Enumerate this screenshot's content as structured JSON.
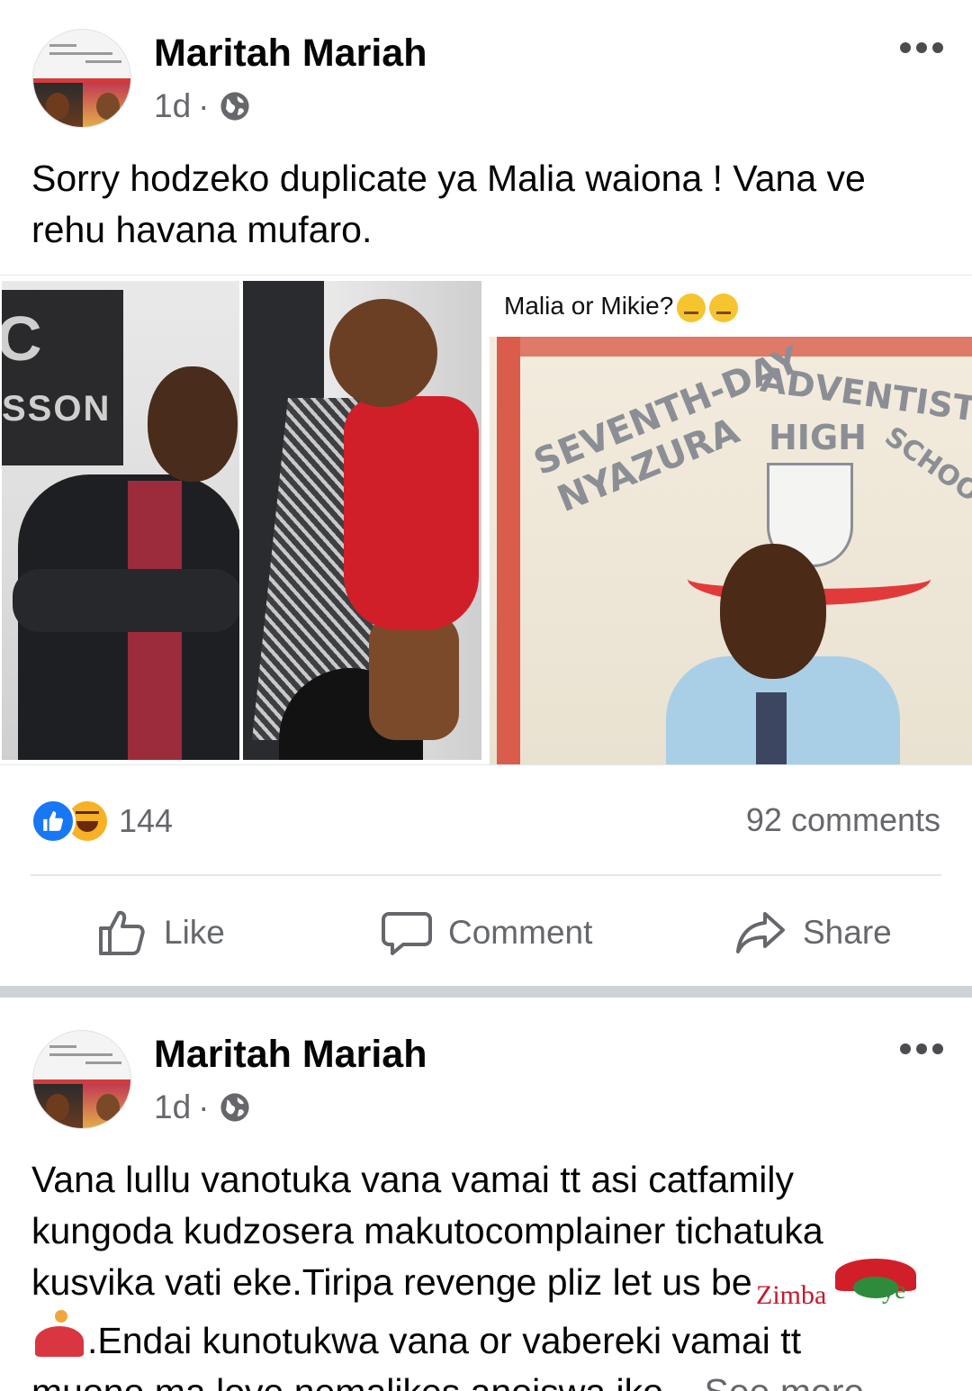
{
  "post1": {
    "author": "Maritah Mariah",
    "time": "1d",
    "separator": "·",
    "privacy_icon": "globe-icon",
    "text": "Sorry hodzeko duplicate ya Malia waiona ! Vana ve rehu havana mufaro.",
    "photos": {
      "caption": "Malia or Mikie?",
      "caption_emoji": "thinking-face-emoji"
    },
    "reactions": {
      "icons": [
        "like-reaction-icon",
        "haha-reaction-icon"
      ],
      "count": "144"
    },
    "comments": "92 comments",
    "actions": {
      "like": "Like",
      "comment": "Comment",
      "share": "Share"
    }
  },
  "post2": {
    "author": "Maritah Mariah",
    "time": "1d",
    "separator": "·",
    "privacy_icon": "globe-icon",
    "text_line1": "Vana lullu vanotuka vana vamai tt  asi catfamily",
    "text_line2": "kungoda kudzosera makutocomplainer tichatuka",
    "text_line3": "kusvika vati eke.Tiripa revenge  pliz let us be",
    "text_line4": ".Endai kunotukwa vana or vabereki vamai tt",
    "text_line5": "muono ma love nemalikes anoiswa iko...",
    "see_more": "See more"
  },
  "watermark": {
    "brand": "Zimba",
    "suffix": "ye"
  },
  "colors": {
    "accent": "#1877f2",
    "muted_text": "#65676b",
    "divider": "#e4e6eb"
  }
}
